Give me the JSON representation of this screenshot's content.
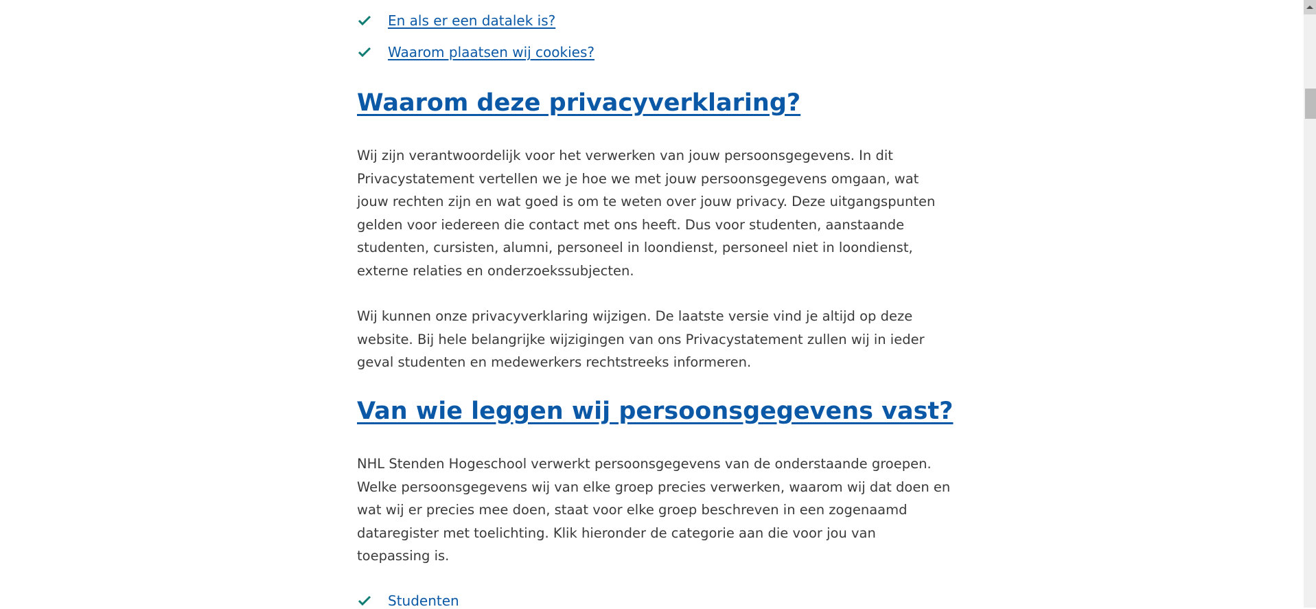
{
  "toc_links": [
    {
      "label": "En als er een datalek is?",
      "icon": "check-icon"
    },
    {
      "label": "Waarom plaatsen wij cookies?",
      "icon": "check-icon"
    }
  ],
  "section1": {
    "heading": "Waarom deze privacyverklaring?",
    "paragraphs": [
      "Wij zijn verantwoordelijk voor het verwerken van jouw persoonsgegevens. In dit Privacystatement vertellen we je hoe we met jouw persoonsgegevens omgaan, wat jouw rechten zijn en wat goed is om te weten over jouw privacy. Deze uitgangspunten gelden voor iedereen die contact met ons heeft. Dus voor studenten, aanstaande studenten, cursisten, alumni, personeel in loondienst, personeel niet in loondienst, externe relaties en onderzoekssubjecten.",
      "Wij kunnen onze privacyverklaring wijzigen. De laatste versie vind je altijd op deze website. Bij hele belangrijke wijzigingen van ons Privacystatement zullen wij in ieder geval studenten en medewerkers rechtstreeks informeren."
    ]
  },
  "section2": {
    "heading": "Van wie leggen wij persoonsgegevens vast?",
    "paragraph": "NHL Stenden Hogeschool verwerkt persoonsgegevens van de onderstaande groepen. Welke persoonsgegevens wij van elke groep precies verwerken, waarom wij dat doen en wat wij er precies mee doen, staat voor elke groep beschreven in een zogenaamd dataregister met toelichting. Klik hieronder de categorie aan die voor jou van toepassing is.",
    "groups": [
      {
        "label": "Studenten",
        "icon": "check-icon"
      }
    ]
  },
  "colors": {
    "link": "#0b59a6",
    "check": "#0f7d74",
    "text": "#3a3a3a"
  }
}
